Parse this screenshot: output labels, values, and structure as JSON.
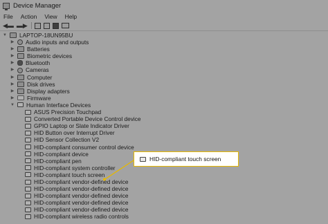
{
  "window": {
    "title": "Device Manager"
  },
  "menu": [
    "File",
    "Action",
    "View",
    "Help"
  ],
  "toolbar": {
    "buttons": [
      "back-arrow-icon",
      "forward-arrow-icon",
      "properties-icon",
      "help-icon",
      "scan-icon",
      "monitor-icon"
    ]
  },
  "tree": {
    "root": "LAPTOP-18UN95BU",
    "categories": [
      "Audio inputs and outputs",
      "Batteries",
      "Biometric devices",
      "Bluetooth",
      "Cameras",
      "Computer",
      "Disk drives",
      "Display adapters",
      "Firmware",
      "Human Interface Devices"
    ],
    "hid_devices": [
      "ASUS Precision Touchpad",
      "Converted Portable Device Control device",
      "GPIO Laptop or Slate Indicator Driver",
      "HID Button over Interrupt Driver",
      "HID Sensor Collection V2",
      "HID-compliant consumer control device",
      "HID-compliant device",
      "HID-compliant pen",
      "HID-compliant system controller",
      "HID-compliant touch screen",
      "HID-compliant vendor-defined device",
      "HID-compliant vendor-defined device",
      "HID-compliant vendor-defined device",
      "HID-compliant vendor-defined device",
      "HID-compliant vendor-defined device",
      "HID-compliant wireless radio controls"
    ]
  },
  "callout": {
    "label": "HID-compliant touch screen",
    "accent": "#e6b800"
  }
}
